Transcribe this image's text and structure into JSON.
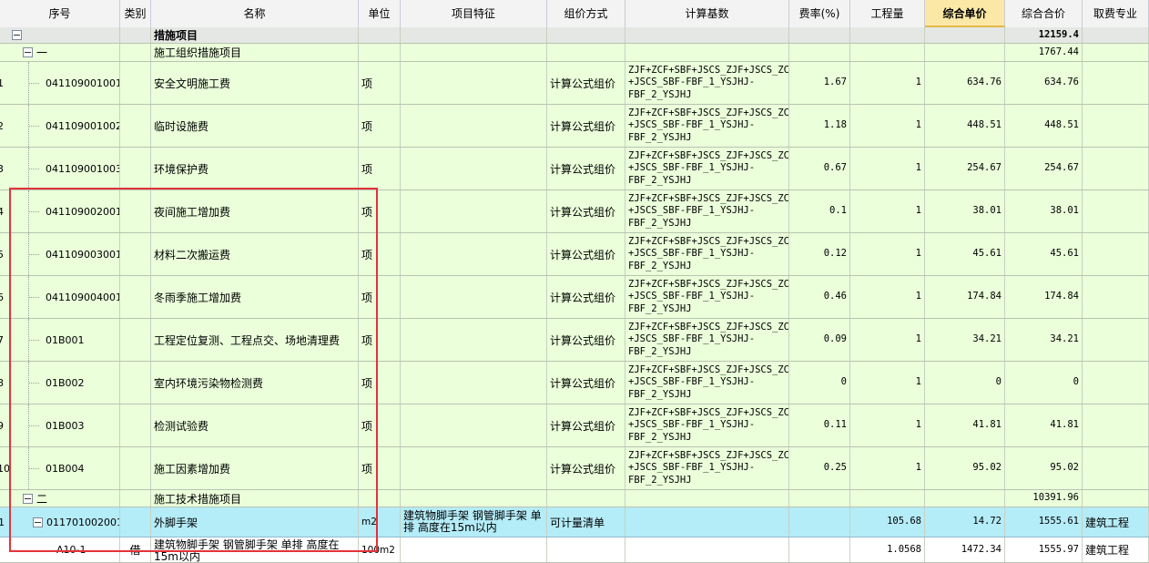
{
  "columns": [
    "序号",
    "类别",
    "名称",
    "单位",
    "项目特征",
    "组价方式",
    "计算基数",
    "费率(%)",
    "工程量",
    "综合单价",
    "综合合价",
    "取费专业"
  ],
  "active_column": "综合单价",
  "formula": "ZJF+ZCF+SBF+JSCS_ZJF+JSCS_ZCF+JSCS_SBF-FBF_1_YSJHJ-FBF_2_YSJHJ",
  "formula_lines": [
    "ZJF+ZCF+SBF+JSCS_ZJF+JSCS_ZCF",
    "+JSCS_SBF-FBF_1_YSJHJ-",
    "FBF_2_YSJHJ"
  ],
  "rows": [
    {
      "kind": "root",
      "name": "措施项目",
      "total": "12159.4"
    },
    {
      "kind": "group",
      "code": "一",
      "name": "施工组织措施项目",
      "total": "1767.44"
    },
    {
      "kind": "item",
      "idx": "1",
      "code": "041109001001",
      "name": "安全文明施工费",
      "unit": "项",
      "method": "计算公式组价",
      "rate": "1.67",
      "qty": "1",
      "price": "634.76",
      "total": "634.76"
    },
    {
      "kind": "item",
      "idx": "2",
      "code": "041109001002",
      "name": "临时设施费",
      "unit": "项",
      "method": "计算公式组价",
      "rate": "1.18",
      "qty": "1",
      "price": "448.51",
      "total": "448.51"
    },
    {
      "kind": "item",
      "idx": "3",
      "code": "041109001003",
      "name": "环境保护费",
      "unit": "项",
      "method": "计算公式组价",
      "rate": "0.67",
      "qty": "1",
      "price": "254.67",
      "total": "254.67"
    },
    {
      "kind": "item",
      "idx": "4",
      "code": "041109002001",
      "name": "夜间施工增加费",
      "unit": "项",
      "method": "计算公式组价",
      "rate": "0.1",
      "qty": "1",
      "price": "38.01",
      "total": "38.01"
    },
    {
      "kind": "item",
      "idx": "5",
      "code": "041109003001",
      "name": "材料二次搬运费",
      "unit": "项",
      "method": "计算公式组价",
      "rate": "0.12",
      "qty": "1",
      "price": "45.61",
      "total": "45.61"
    },
    {
      "kind": "item",
      "idx": "6",
      "code": "041109004001",
      "name": "冬雨季施工增加费",
      "unit": "项",
      "method": "计算公式组价",
      "rate": "0.46",
      "qty": "1",
      "price": "174.84",
      "total": "174.84"
    },
    {
      "kind": "item",
      "idx": "7",
      "code": "01B001",
      "name": "工程定位复测、工程点交、场地清理费",
      "unit": "项",
      "method": "计算公式组价",
      "rate": "0.09",
      "qty": "1",
      "price": "34.21",
      "total": "34.21"
    },
    {
      "kind": "item",
      "idx": "8",
      "code": "01B002",
      "name": "室内环境污染物检测费",
      "unit": "项",
      "method": "计算公式组价",
      "rate": "0",
      "qty": "1",
      "price": "0",
      "total": "0"
    },
    {
      "kind": "item",
      "idx": "9",
      "code": "01B003",
      "name": "检测试验费",
      "unit": "项",
      "method": "计算公式组价",
      "rate": "0.11",
      "qty": "1",
      "price": "41.81",
      "total": "41.81"
    },
    {
      "kind": "item",
      "idx": "10",
      "code": "01B004",
      "name": "施工因素增加费",
      "unit": "项",
      "method": "计算公式组价",
      "rate": "0.25",
      "qty": "1",
      "price": "95.02",
      "total": "95.02"
    },
    {
      "kind": "group",
      "code": "二",
      "name": "施工技术措施项目",
      "total": "10391.96"
    },
    {
      "kind": "selected",
      "idx": "1",
      "code": "011701002001",
      "name": "外脚手架",
      "unit": "m2",
      "feature": "建筑物脚手架 钢管脚手架 单排 高度在15m以内",
      "method": "可计量清单",
      "qty": "105.68",
      "price": "14.72",
      "total": "1555.61",
      "fee": "建筑工程"
    },
    {
      "kind": "sub",
      "idx": "",
      "code": "A10-1",
      "cat": "借",
      "name": "建筑物脚手架 钢管脚手架 单排 高度在15m以内",
      "unit": "100m2",
      "qty": "1.0568",
      "price": "1472.34",
      "total": "1555.97",
      "fee": "建筑工程"
    }
  ]
}
